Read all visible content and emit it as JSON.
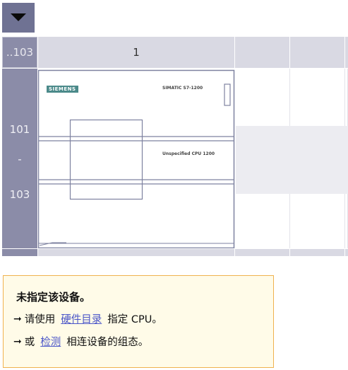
{
  "toolbar": {
    "collapse_icon": "triangle-down-icon"
  },
  "grid": {
    "slot_range_header": "..103",
    "column_headers": [
      "1",
      "",
      "",
      ""
    ],
    "row_labels": {
      "start": "101",
      "dash": "-",
      "end": "103"
    }
  },
  "device": {
    "brand": "SIEMENS",
    "product_line": "SIMATIC S7-1200",
    "model": "Unspecified CPU 1200"
  },
  "info": {
    "title": "未指定该设备。",
    "line1": {
      "prefix": "请使用",
      "link": "硬件目录",
      "suffix": "指定 CPU。"
    },
    "line2": {
      "prefix": "或",
      "link": "检测",
      "suffix": "相连设备的组态。"
    },
    "arrow_icon": "arrow-right-icon"
  },
  "colors": {
    "header_dark": "#6f7293",
    "gutter": "#8b8ca8",
    "header_light": "#d9d9e3",
    "info_border": "#f0b24f",
    "info_bg": "#fffbe8",
    "link": "#4a55c8"
  }
}
